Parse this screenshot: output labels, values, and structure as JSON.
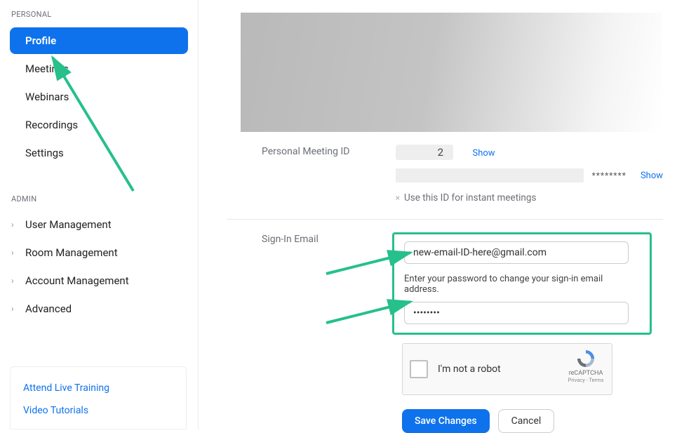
{
  "sidebar": {
    "section_personal": "PERSONAL",
    "items": [
      {
        "label": "Profile"
      },
      {
        "label": "Meetings"
      },
      {
        "label": "Webinars"
      },
      {
        "label": "Recordings"
      },
      {
        "label": "Settings"
      }
    ],
    "section_admin": "ADMIN",
    "admin_items": [
      {
        "label": "User Management"
      },
      {
        "label": "Room Management"
      },
      {
        "label": "Account Management"
      },
      {
        "label": "Advanced"
      }
    ],
    "bottom_links": [
      {
        "label": "Attend Live Training"
      },
      {
        "label": "Video Tutorials"
      }
    ]
  },
  "main": {
    "pmi": {
      "label": "Personal Meeting ID",
      "visible_digit": "2",
      "show_label": "Show",
      "url_dots": "********",
      "show_label_2": "Show",
      "instant_text": "Use this ID for instant meetings"
    },
    "signin": {
      "label": "Sign-In Email",
      "email_value": "new-email-ID-here@gmail.com",
      "helper": "Enter your password to change your sign-in email address.",
      "password_value": "••••••••"
    },
    "recaptcha": {
      "label": "I'm not a robot",
      "name": "reCAPTCHA",
      "privacy": "Privacy - Terms"
    },
    "buttons": {
      "save": "Save Changes",
      "cancel": "Cancel"
    }
  }
}
